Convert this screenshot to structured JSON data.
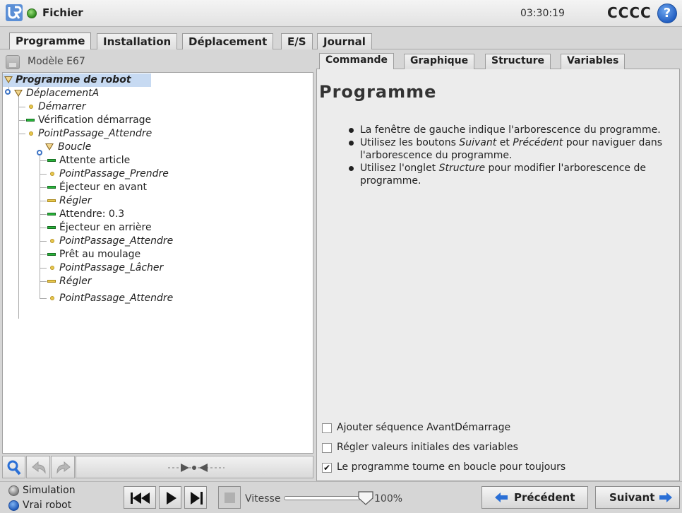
{
  "titlebar": {
    "file_menu": "Fichier",
    "clock": "03:30:19",
    "robot_name": "CCCC",
    "help_symbol": "?"
  },
  "main_tabs": [
    "Programme",
    "Installation",
    "Déplacement",
    "E/S",
    "Journal"
  ],
  "active_main_tab": "Programme",
  "left": {
    "model_name": "Modèle E67",
    "tree": [
      {
        "label": "Programme de robot",
        "style": "bold-italic",
        "marker": "triangle-icon"
      },
      {
        "label": "DéplacementA",
        "style": "italic",
        "marker": "triangle-icon"
      },
      {
        "label": "Démarrer",
        "style": "italic",
        "marker": "waypoint-dot-icon"
      },
      {
        "label": "Vérification démarrage",
        "style": "normal",
        "marker": "green-bar-icon"
      },
      {
        "label": "PointPassage_Attendre",
        "style": "italic",
        "marker": "waypoint-dot-icon"
      },
      {
        "label": "Boucle",
        "style": "italic",
        "marker": "triangle-icon"
      },
      {
        "label": "Attente article",
        "style": "normal",
        "marker": "green-bar-icon"
      },
      {
        "label": "PointPassage_Prendre",
        "style": "italic",
        "marker": "waypoint-dot-icon"
      },
      {
        "label": "Éjecteur en avant",
        "style": "normal",
        "marker": "green-bar-icon"
      },
      {
        "label": "Régler",
        "style": "italic",
        "marker": "yellow-bar-icon"
      },
      {
        "label": "Attendre: 0.3",
        "style": "normal",
        "marker": "green-bar-icon"
      },
      {
        "label": "Éjecteur en arrière",
        "style": "normal",
        "marker": "green-bar-icon"
      },
      {
        "label": "PointPassage_Attendre",
        "style": "italic",
        "marker": "waypoint-dot-icon"
      },
      {
        "label": "Prêt au moulage",
        "style": "normal",
        "marker": "green-bar-icon"
      },
      {
        "label": "PointPassage_Lâcher",
        "style": "italic",
        "marker": "waypoint-dot-icon"
      },
      {
        "label": "Régler",
        "style": "italic",
        "marker": "yellow-bar-icon"
      },
      {
        "label": "PointPassage_Attendre",
        "style": "italic",
        "marker": "waypoint-dot-icon"
      }
    ],
    "toolbar_icons": [
      "search-icon",
      "undo-icon",
      "redo-icon",
      "play-marker-icon"
    ]
  },
  "right": {
    "sub_tabs": [
      "Commande",
      "Graphique",
      "Structure",
      "Variables"
    ],
    "active_sub_tab": "Commande",
    "title": "Programme",
    "bullets": [
      {
        "parts": [
          "La fenêtre de gauche indique l'arborescence du programme."
        ]
      },
      {
        "parts": [
          "Utilisez les boutons ",
          "Suivant",
          " et ",
          "Précédent",
          " pour naviguer dans",
          "l'arborescence du programme."
        ]
      },
      {
        "parts": [
          "Utilisez l'onglet ",
          "Structure",
          " pour modifier l'arborescence de programme."
        ]
      }
    ],
    "checkboxes": [
      {
        "label": "Ajouter séquence AvantDémarrage",
        "checked": false
      },
      {
        "label": "Régler valeurs initiales des variables",
        "checked": false
      },
      {
        "label": "Le programme tourne en boucle pour toujours",
        "checked": true
      }
    ],
    "check_mark": "✔"
  },
  "footer": {
    "mode_simulation": "Simulation",
    "mode_real": "Vrai robot",
    "speed_label": "Vitesse",
    "speed_value": "100%",
    "speed_fraction": 1.0,
    "prev_button": "Précédent",
    "next_button": "Suivant",
    "transport_icons": [
      "skip-back-icon",
      "play-icon",
      "step-forward-icon",
      "stop-icon"
    ]
  },
  "colors": {
    "accent_blue": "#2a6fd6",
    "ok_green": "#2f8b1e",
    "tree_selection": "#c7daf2"
  }
}
